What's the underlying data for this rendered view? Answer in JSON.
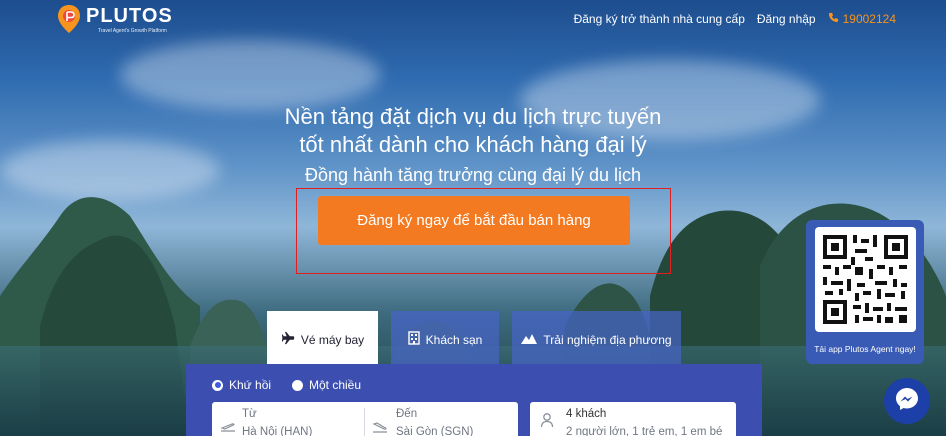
{
  "brand": {
    "name": "PLUTOS",
    "tagline": "Travel Agent's Growth Platform"
  },
  "nav": {
    "supplier_signup": "Đăng ký trở thành nhà cung cấp",
    "login": "Đăng nhập",
    "hotline": "19002124"
  },
  "hero": {
    "line1": "Nền tảng đặt dịch vụ du lịch trực tuyến",
    "line2": "tốt nhất dành cho khách hàng đại lý",
    "line3": "Đồng hành tăng trưởng cùng đại lý du lịch",
    "cta": "Đăng ký ngay để bắt đầu bán hàng"
  },
  "qr": {
    "caption": "Tải app Plutos Agent ngay!"
  },
  "tabs": [
    {
      "label": "Vé máy bay",
      "icon": "airplane-icon",
      "active": true
    },
    {
      "label": "Khách sạn",
      "icon": "building-icon",
      "active": false
    },
    {
      "label": "Trải nghiệm địa phương",
      "icon": "mountain-icon",
      "active": false
    }
  ],
  "trip_type": [
    {
      "label": "Khứ hồi",
      "selected": true
    },
    {
      "label": "Một chiều",
      "selected": false
    }
  ],
  "search": {
    "from_label": "Từ",
    "from_value": "Hà Nội (HAN)",
    "to_label": "Đến",
    "to_value": "Sài Gòn (SGN)",
    "guests_label": "4 khách",
    "guests_value": "2 người lớn, 1 trẻ em, 1 em bé"
  },
  "colors": {
    "accent": "#f37a20",
    "panel": "#3c4fb0",
    "qr_card": "#3a5bb5"
  }
}
